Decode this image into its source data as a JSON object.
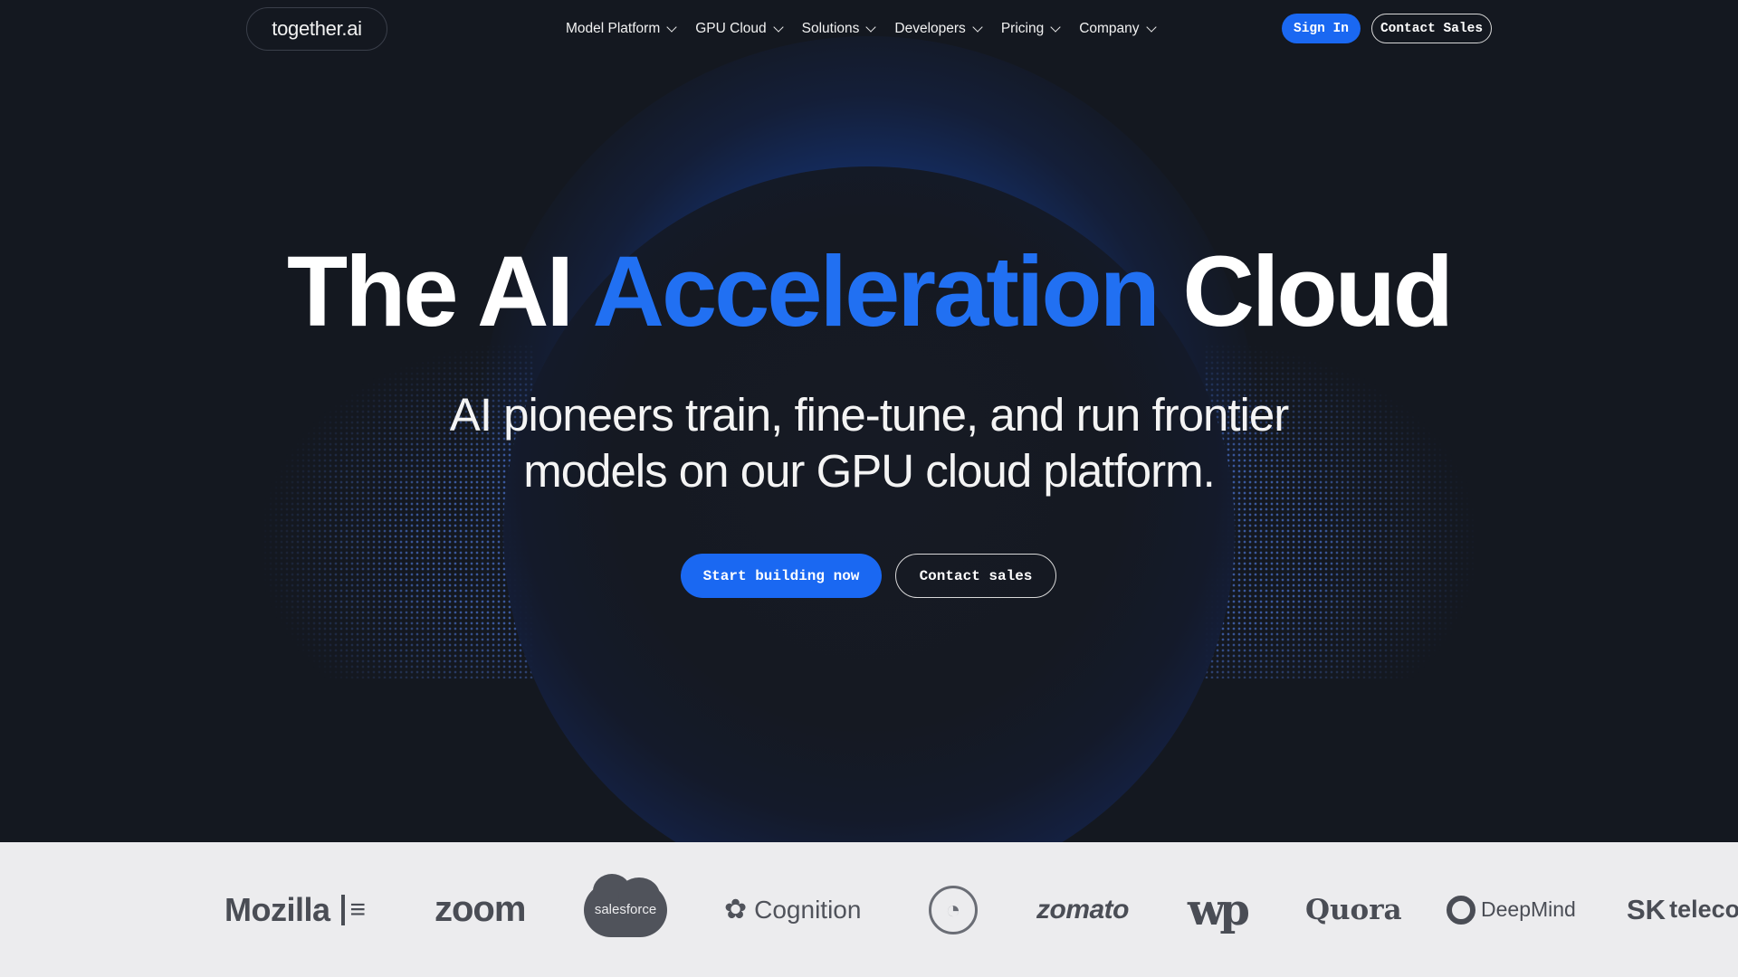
{
  "nav": {
    "logo": "together.ai",
    "menu": [
      {
        "label": "Model Platform"
      },
      {
        "label": "GPU Cloud"
      },
      {
        "label": "Solutions"
      },
      {
        "label": "Developers"
      },
      {
        "label": "Pricing"
      },
      {
        "label": "Company"
      }
    ],
    "sign_in": "Sign In",
    "contact_sales": "Contact Sales"
  },
  "hero": {
    "headline_part1": "The AI ",
    "headline_accent": "Acceleration",
    "headline_part2": " Cloud",
    "subtitle_line1": "AI pioneers train, fine-tune, and run frontier",
    "subtitle_line2": "models on our GPU cloud platform.",
    "cta_primary": "Start building now",
    "cta_secondary": "Contact sales"
  },
  "logos": {
    "mozilla": "Mozilla",
    "zoom": "zoom",
    "salesforce": "salesforce",
    "cognition": "Cognition",
    "duckduckgo": "duckduckgo-logo",
    "zomato": "zomato",
    "washington_post": "wp",
    "quora": "Quora",
    "deepmind": "DeepMind",
    "sk_telecom_sk": "SK",
    "sk_telecom_tel": "teleco"
  },
  "colors": {
    "background": "#141820",
    "accent": "#2170f2",
    "button_blue": "#1a68f2",
    "logo_strip": "#ececee"
  }
}
